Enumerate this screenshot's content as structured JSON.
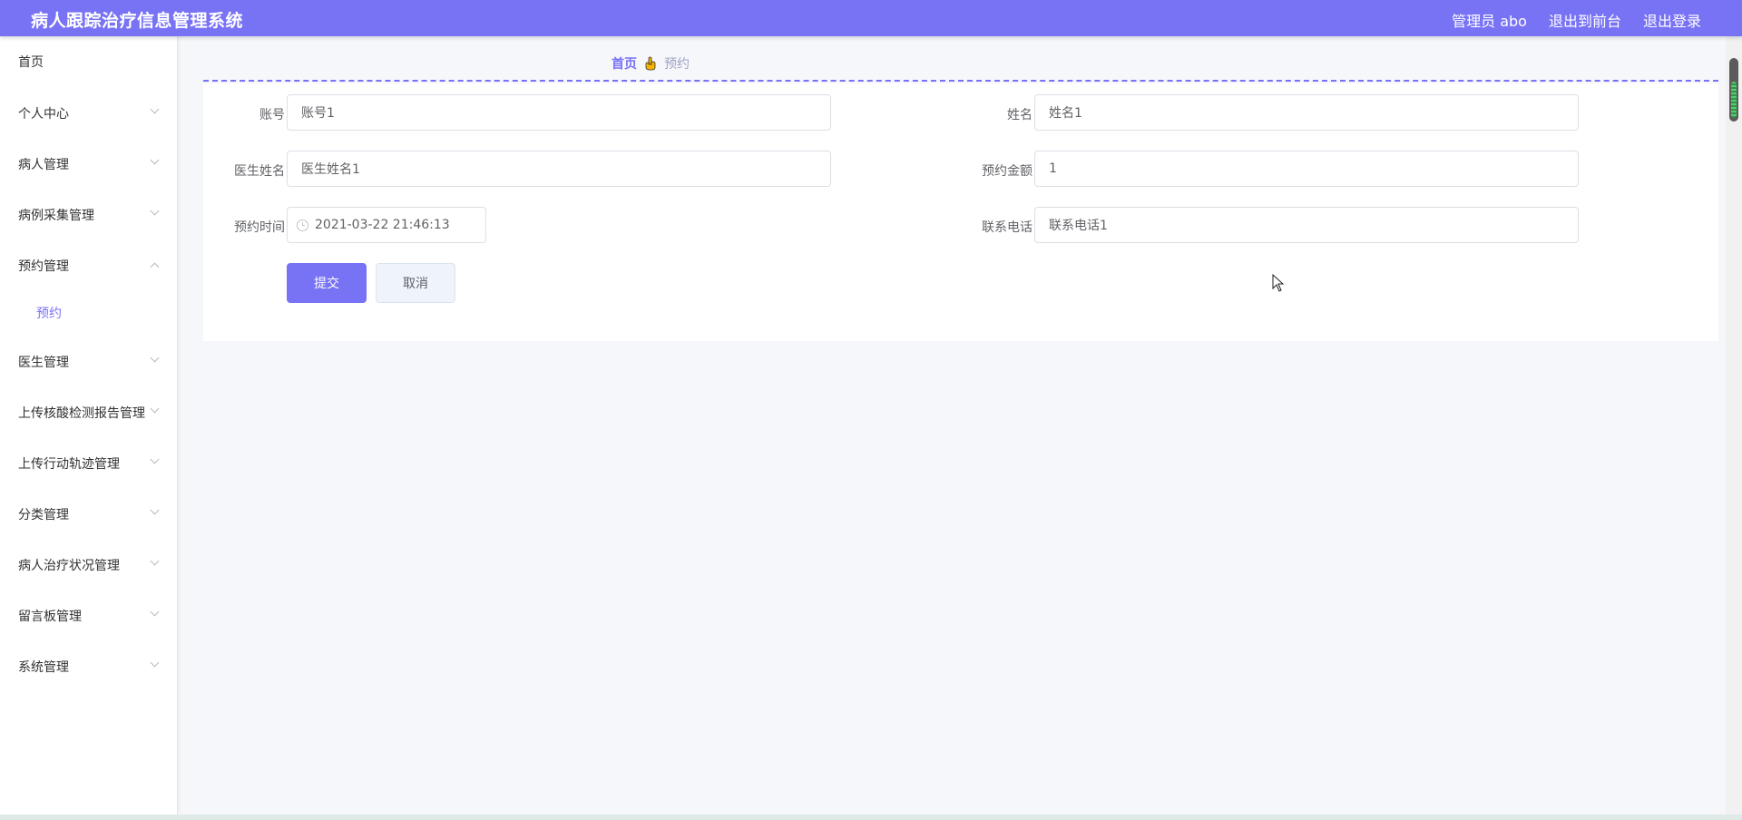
{
  "app": {
    "title": "病人跟踪治疗信息管理系统",
    "user_label": "管理员 abo",
    "to_front_label": "退出到前台",
    "logout_label": "退出登录"
  },
  "sidebar": {
    "items": [
      {
        "label": "首页"
      },
      {
        "label": "个人中心"
      },
      {
        "label": "病人管理"
      },
      {
        "label": "病例采集管理"
      },
      {
        "label": "预约管理"
      },
      {
        "label": "预约"
      },
      {
        "label": "医生管理"
      },
      {
        "label": "上传核酸检测报告管理"
      },
      {
        "label": "上传行动轨迹管理"
      },
      {
        "label": "分类管理"
      },
      {
        "label": "病人治疗状况管理"
      },
      {
        "label": "留言板管理"
      },
      {
        "label": "系统管理"
      }
    ]
  },
  "breadcrumb": {
    "home": "首页",
    "icon": "hand-icon",
    "current": "预约"
  },
  "form": {
    "account": {
      "label": "账号",
      "value": "账号1"
    },
    "name": {
      "label": "姓名",
      "value": "姓名1"
    },
    "doctor_name": {
      "label": "医生姓名",
      "value": "医生姓名1"
    },
    "amount": {
      "label": "预约金额",
      "value": "1"
    },
    "time": {
      "label": "预约时间",
      "value": "2021-03-22 21:46:13"
    },
    "phone": {
      "label": "联系电话",
      "value": "联系电话1"
    },
    "submit_label": "提交",
    "cancel_label": "取消"
  },
  "colors": {
    "accent": "#7872f5",
    "background": "#f5f7fa"
  }
}
